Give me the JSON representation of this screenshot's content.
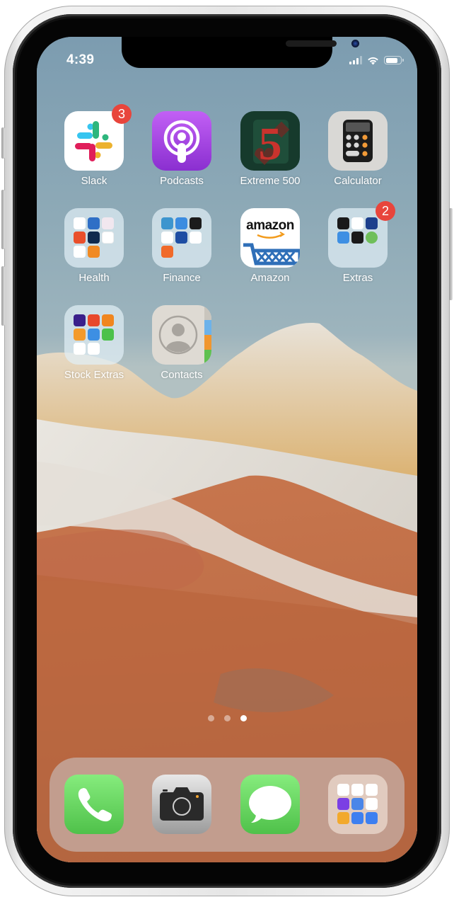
{
  "status_bar": {
    "time": "4:39",
    "signal_bars_active": 3,
    "signal_bars_total": 4,
    "wifi_icon": "wifi-icon",
    "battery_level": 0.7
  },
  "home_screen": {
    "apps": [
      {
        "id": "slack",
        "label": "Slack",
        "badge": "3",
        "type": "app",
        "icon": "slack-logo-icon"
      },
      {
        "id": "podcasts",
        "label": "Podcasts",
        "badge": null,
        "type": "app",
        "icon": "podcasts-icon"
      },
      {
        "id": "extreme-500",
        "label": "Extreme 500",
        "badge": null,
        "type": "app",
        "icon": "extreme-500-icon"
      },
      {
        "id": "calculator",
        "label": "Calculator",
        "badge": null,
        "type": "app",
        "icon": "calculator-icon"
      },
      {
        "id": "health",
        "label": "Health",
        "badge": null,
        "type": "folder",
        "icon": "folder-icon"
      },
      {
        "id": "finance",
        "label": "Finance",
        "badge": null,
        "type": "folder",
        "icon": "folder-icon"
      },
      {
        "id": "amazon",
        "label": "Amazon",
        "badge": null,
        "type": "app",
        "icon": "amazon-cart-icon",
        "logo_text": "amazon"
      },
      {
        "id": "extras",
        "label": "Extras",
        "badge": "2",
        "type": "folder",
        "icon": "folder-icon"
      },
      {
        "id": "stock-extras",
        "label": "Stock Extras",
        "badge": null,
        "type": "folder",
        "icon": "folder-icon"
      },
      {
        "id": "contacts",
        "label": "Contacts",
        "badge": null,
        "type": "app",
        "icon": "contacts-icon"
      }
    ],
    "page_indicator": {
      "pages": 3,
      "current": 3
    }
  },
  "dock": {
    "apps": [
      {
        "id": "phone",
        "label": "Phone",
        "icon": "phone-icon"
      },
      {
        "id": "camera",
        "label": "Camera",
        "icon": "camera-icon"
      },
      {
        "id": "messages",
        "label": "Messages",
        "icon": "messages-icon"
      },
      {
        "id": "dock-folder",
        "label": "Folder",
        "icon": "folder-icon"
      }
    ]
  },
  "colors": {
    "badge": "#e8453c",
    "podcasts": "#9c3fd9",
    "phone_green": "#5fd35c",
    "sky": "#7f9fb1",
    "rock_orange": "#b8623a"
  }
}
